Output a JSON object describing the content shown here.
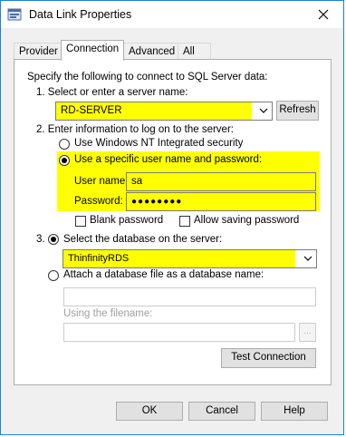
{
  "window": {
    "title": "Data Link Properties"
  },
  "tabs": [
    {
      "label": "Provider"
    },
    {
      "label": "Connection"
    },
    {
      "label": "Advanced"
    },
    {
      "label": "All"
    }
  ],
  "connection": {
    "intro": "Specify the following to connect to SQL Server data:",
    "step1_label": "1. Select or enter a server name:",
    "server_value": "RD-SERVER",
    "refresh_label": "Refresh",
    "step2_label": "2. Enter information to log on to the server:",
    "nt_security_label": "Use Windows NT Integrated security",
    "specific_user_label": "Use a specific user name and password:",
    "username_label": "User name:",
    "username_value": "sa",
    "password_label": "Password:",
    "password_value": "●●●●●●●●",
    "blank_password_label": "Blank password",
    "allow_saving_label": "Allow saving password",
    "step3_prefix": "3.",
    "select_db_label": "Select the database on the server:",
    "database_value": "ThinfinityRDS",
    "attach_label": "Attach a database file as a database name:",
    "attach_value": "",
    "filename_label": "Using the filename:",
    "filename_value": "",
    "browse_label": "...",
    "test_connection_label": "Test Connection"
  },
  "footer": {
    "ok_label": "OK",
    "cancel_label": "Cancel",
    "help_label": "Help"
  },
  "colors": {
    "highlight": "#ffff00",
    "title_border": "#1883d7"
  },
  "icons": [
    "data-link-icon",
    "close-icon",
    "chevron-down-icon"
  ]
}
